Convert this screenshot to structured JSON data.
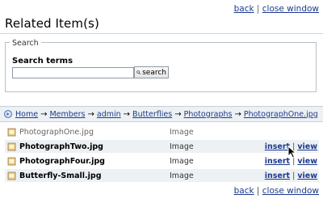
{
  "links": {
    "back": "back",
    "separator": "|",
    "close_window": "close window"
  },
  "page_title": "Related Item(s)",
  "search": {
    "legend": "Search",
    "label": "Search terms",
    "value": "",
    "button_label": "search"
  },
  "breadcrumb": {
    "items": [
      "Home",
      "Members",
      "admin",
      "Butterflies",
      "Photographs",
      "PhotographOne.jpg"
    ],
    "arrow": "→"
  },
  "items": [
    {
      "name": "PhotographOne.jpg",
      "type": "Image",
      "state": "current"
    },
    {
      "name": "PhotographTwo.jpg",
      "type": "Image",
      "insert": "insert",
      "view": "view"
    },
    {
      "name": "PhotographFour.jpg",
      "type": "Image",
      "insert": "insert",
      "view": "view"
    },
    {
      "name": "Butterfly-Small.jpg",
      "type": "Image",
      "insert": "insert",
      "view": "view"
    }
  ],
  "colors": {
    "link": "#1b3a8c",
    "row_alt": "#eef1f4",
    "file_icon": "#d9b56a"
  }
}
